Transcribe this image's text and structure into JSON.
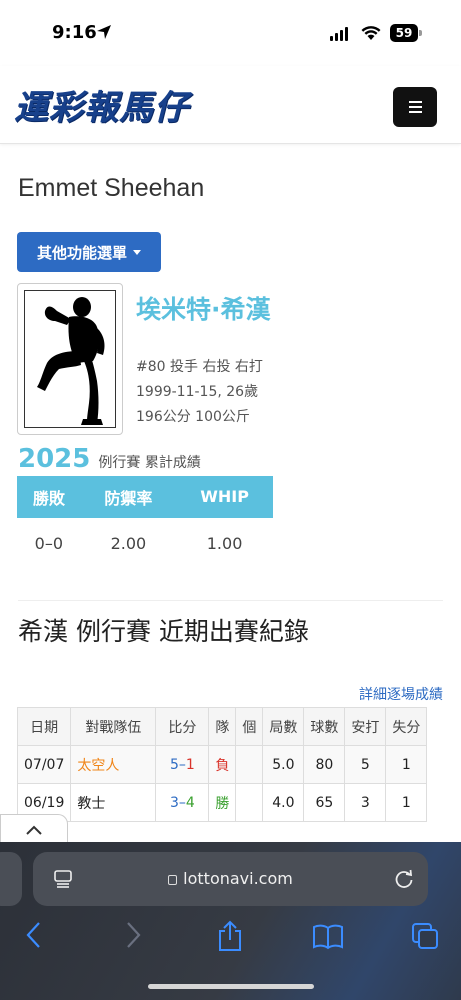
{
  "status_bar": {
    "time": "9:16",
    "battery": "59"
  },
  "site": {
    "logo_text": "運彩報馬仔"
  },
  "player": {
    "name_en": "Emmet Sheehan",
    "menu_button_label": "其他功能選單",
    "name_zh": "埃米特·希漢",
    "info_lines": [
      "#80 投手 右投 右打",
      "1999-11-15, 26歲",
      "196公分 100公斤"
    ]
  },
  "season_stats": {
    "year": "2025",
    "label": "例行賽 累計成績",
    "headers": [
      "勝敗",
      "防禦率",
      "WHIP"
    ],
    "values": [
      "0–0",
      "2.00",
      "1.00"
    ]
  },
  "recent_games": {
    "title": "希漢 例行賽 近期出賽紀錄",
    "detail_link": "詳細逐場成績",
    "headers": [
      "日期",
      "對戰隊伍",
      "比分",
      "隊",
      "個",
      "局數",
      "球數",
      "安打",
      "失分"
    ],
    "rows": [
      {
        "date": "07/07",
        "opponent": "太空人",
        "score_a": "5",
        "score_sep": "–",
        "score_b": "1",
        "team_result": "負",
        "ind_result": "",
        "innings": "5.0",
        "pitches": "80",
        "hits": "5",
        "runs": "1"
      },
      {
        "date": "06/19",
        "opponent": "教士",
        "score_a": "3",
        "score_sep": "–",
        "score_b": "4",
        "team_result": "勝",
        "ind_result": "",
        "innings": "4.0",
        "pitches": "65",
        "hits": "3",
        "runs": "1"
      }
    ]
  },
  "browser": {
    "url": "lottonavi.com"
  },
  "colors": {
    "accent_cyan": "#5bc0de",
    "button_blue": "#2d6bc3",
    "logo_blue": "#17408b"
  }
}
